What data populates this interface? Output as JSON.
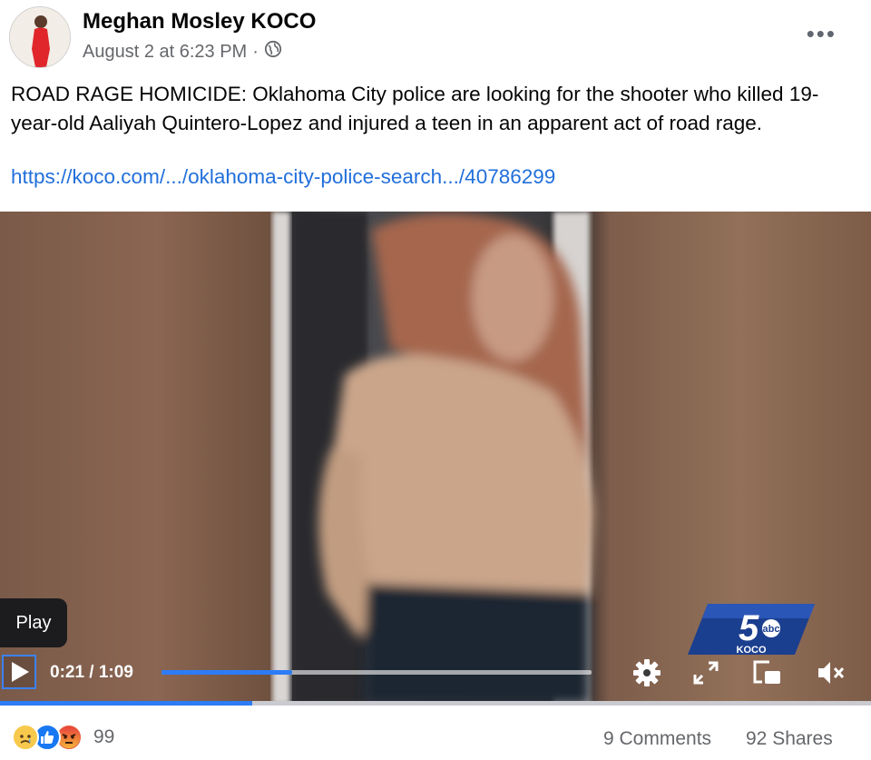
{
  "post": {
    "author": "Meghan Mosley KOCO",
    "timestamp": "August 2 at 6:23 PM",
    "separator": "·",
    "privacy_icon": "globe-icon",
    "more_label": "•••",
    "text": "ROAD RAGE HOMICIDE: Oklahoma City police are looking for the shooter who killed 19-year-old Aaliyah Quintero-Lopez and injured a teen in an apparent act of road rage.",
    "link": "https://koco.com/.../oklahoma-city-police-search.../40786299"
  },
  "video": {
    "tooltip": "Play",
    "current_time": "0:21",
    "duration": "1:09",
    "time_display": "0:21 / 1:09",
    "seek_progress": 0.304,
    "buffer_progress": 0.29,
    "logo_number": "5",
    "logo_network": "abc",
    "logo_station": "KOCO",
    "controls": [
      "settings-icon",
      "fullscreen-icon",
      "pip-icon",
      "mute-icon"
    ]
  },
  "footer": {
    "reaction_icons": [
      "sad-reaction-icon",
      "like-reaction-icon",
      "angry-reaction-icon"
    ],
    "reaction_count": "99",
    "comments": "9 Comments",
    "shares": "92 Shares"
  },
  "colors": {
    "link": "#216fdb",
    "accent": "#2d7cf6",
    "meta": "#65676b"
  }
}
